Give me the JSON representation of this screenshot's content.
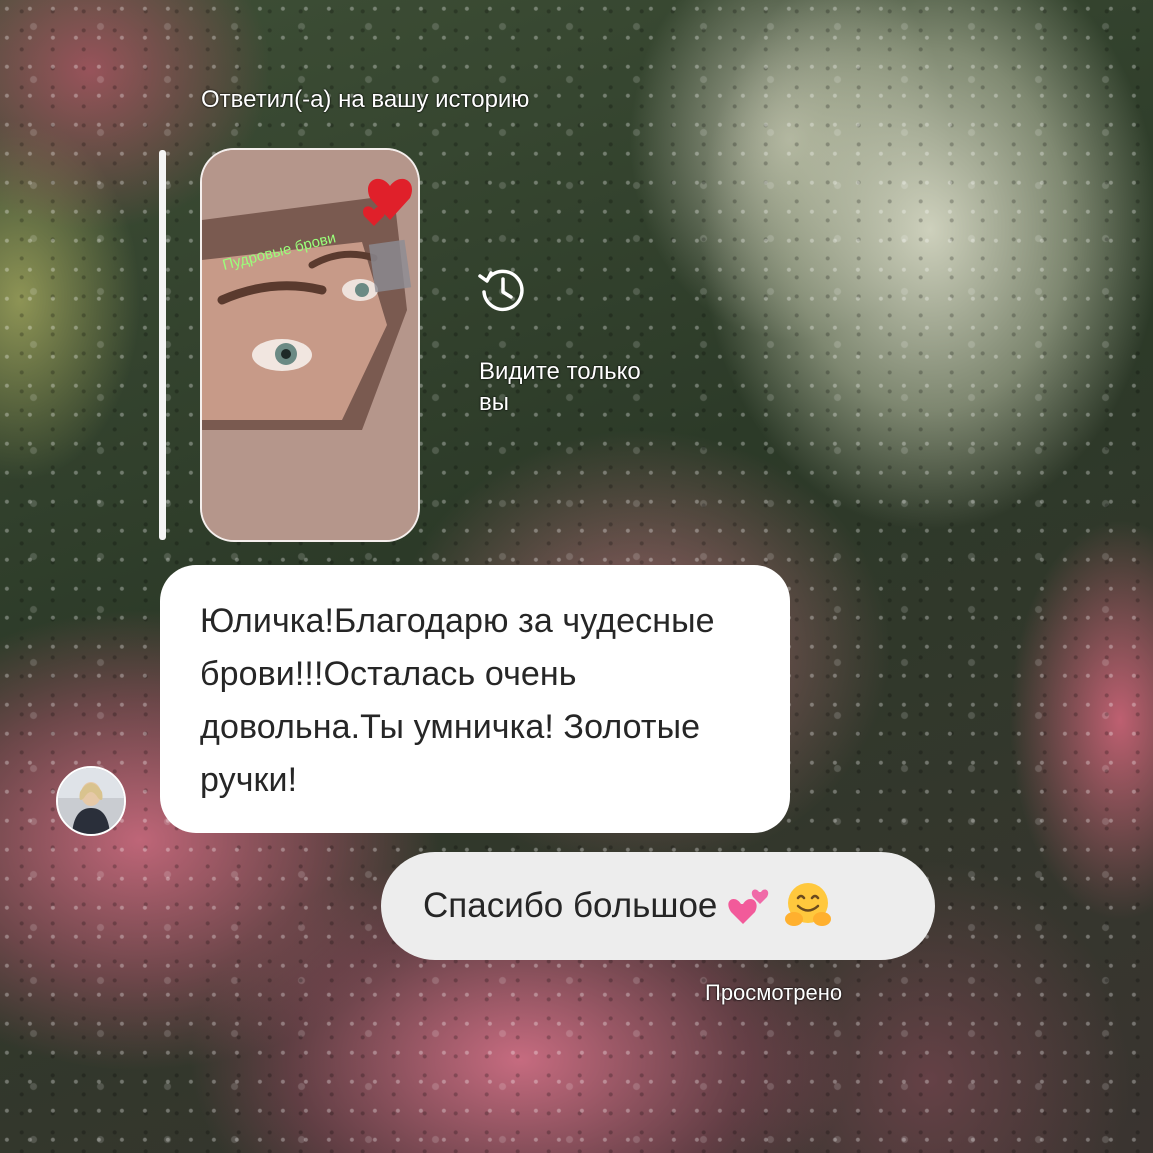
{
  "story_reply": {
    "header": "Ответил(-а) на вашу историю",
    "story_caption": "Пудровые брови",
    "private_note": "Видите только вы",
    "history_icon": "history-clock-icon"
  },
  "messages": [
    {
      "direction": "incoming",
      "text": "Юличка!Благодарю за чудесные брови!!!Осталась очень довольна.Ты умничка! Золотые ручки!"
    },
    {
      "direction": "outgoing",
      "text": "Спасибо большое",
      "emojis": [
        "two-hearts-icon",
        "hugging-face-icon"
      ]
    }
  ],
  "status": {
    "seen": "Просмотрено"
  },
  "colors": {
    "incoming_bubble": "#ffffff",
    "outgoing_bubble": "#ededed",
    "text": "#262626",
    "caption_green": "#9aff7a",
    "heart_red": "#e0202a"
  }
}
